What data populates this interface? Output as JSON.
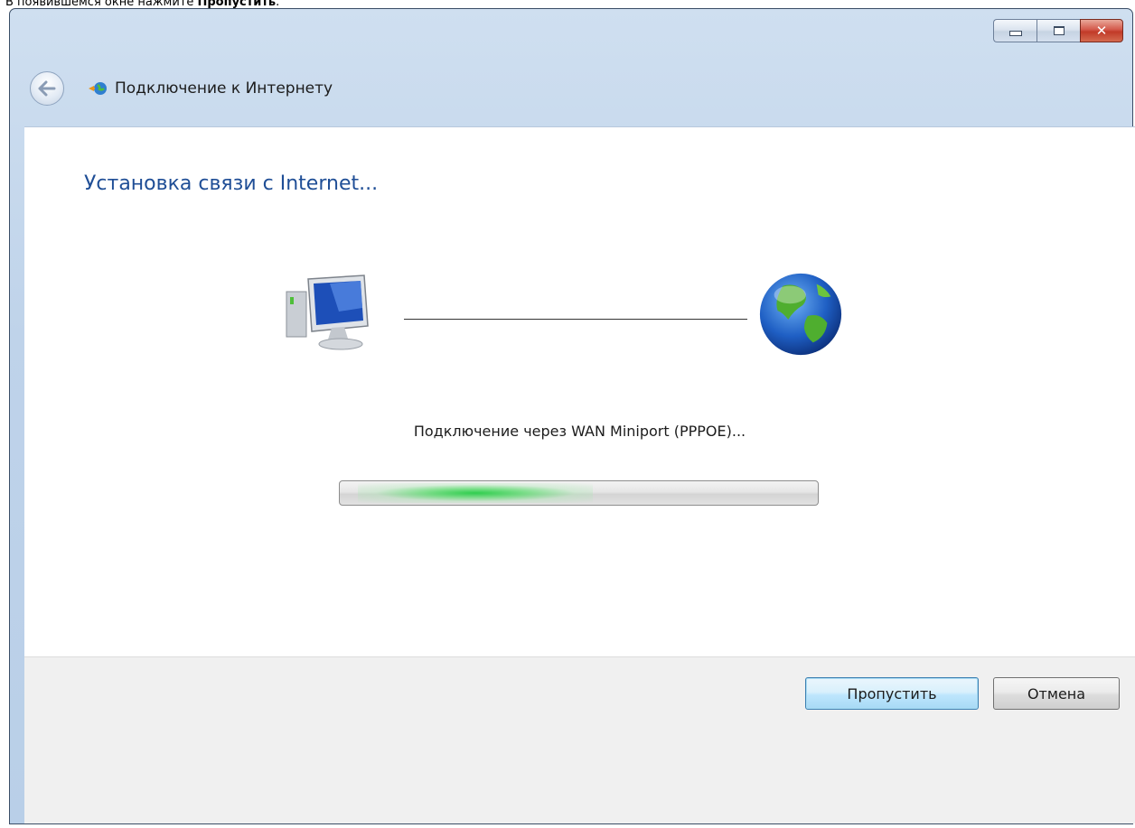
{
  "instruction": {
    "prefix": "В появившемся окне нажмите ",
    "bold": "Пропустить",
    "suffix": "."
  },
  "window": {
    "title": "Подключение к Интернету",
    "controls": {
      "minimize": "",
      "maximize": "",
      "close": "✕"
    }
  },
  "main": {
    "heading": "Установка связи с Internet...",
    "status": "Подключение через WAN Miniport (PPPOE)...",
    "progress_state": "indeterminate"
  },
  "buttons": {
    "skip": "Пропустить",
    "cancel": "Отмена"
  },
  "colors": {
    "heading": "#1f4e96",
    "progress_glow": "#26cd46",
    "title_bar": "#bfd3ea"
  },
  "icons": {
    "back": "back-arrow-icon",
    "title": "network-globe-icon",
    "computer": "computer-icon",
    "globe": "globe-icon"
  }
}
